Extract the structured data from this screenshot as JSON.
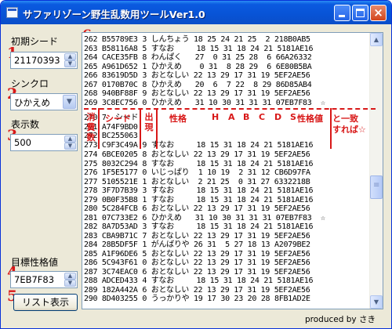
{
  "window": {
    "title": "サファリゾーン野生乱数用ツールVer1.0",
    "controls": {
      "minimize": "_",
      "maximize": "□",
      "close": "×"
    }
  },
  "annotations_numbers": [
    "1",
    "2",
    "3",
    "4",
    "5",
    "6"
  ],
  "left_panel": {
    "initial_seed_label": "初期シード",
    "initial_seed_value": "21170393",
    "synchro_label": "シンクロ",
    "synchro_value": "ひかえめ",
    "display_count_label": "表示数",
    "display_count_value": "500",
    "target_pid_label": "目標性格値",
    "target_pid_value": "7EB7F83",
    "list_button_label": "リスト表示"
  },
  "list_rows_top": [
    "262 B55789E3 3 しんちょう 18 25 24 21 25  2 218B0AB5",
    "263 B58116A8 5 すなお     18 15 31 18 24 21 5181AE16",
    "264 CACE35FB 8 わんぱく   27  0 31 25 28  6 66A26332",
    "265 A961D652 1 ひかえめ    0 31  8 28 29  6 6E80B5BA",
    "266 83619D5D 3 おとなしい 22 13 29 17 31 19 5EF2AE56",
    "267 0170B70C 8 ひかえめ   20  6  7 22  8 29 86D85AB4",
    "268 940BF88F 9 おとなしい 22 13 29 17 31 19 5EF2AE56",
    "269 3C8EC756 0 ひかえめ   31 10 30 31 31 31 07EB7F83  ☆"
  ],
  "list_rows_mid_stubs": [
    "270 7  シード",
    "271 A74F9BD0",
    "272 BC255063",
    "273 C9F3C49A 9 すなお     18 15 31 18 24 21 5181AE16"
  ],
  "list_rows_bottom": [
    "274 6BCE0205 8 おとなしい 22 13 29 17 31 19 5EF2AE56",
    "275 8032C294 8 すなお     18 15 31 18 24 21 5181AE16",
    "276 1F5E5177 0 いじっぱり  1 10 19  2 31 12 CB6D97FA",
    "277 5105521E 1 おとなしい  2 21 25  0 31 27 6332218B",
    "278 3F7D7B39 3 すなお     18 15 31 18 24 21 5181AE16",
    "279 0B0F35B8 1 すなお     18 15 31 18 24 21 5181AE16",
    "280 5C284FCB 6 おとなしい 22 13 29 17 31 19 5EF2AE56",
    "281 07C733E2 6 ひかえめ   31 10 30 31 31 31 07EB7F83  ☆",
    "282 8A7D53AD 3 すなお     18 15 31 18 24 21 5181AE16",
    "283 CBA9B71C 7 おとなしい 22 13 29 17 31 19 5EF2AE56",
    "284 28B5DF5F 1 がんばりや 26 31  5 27 18 13 A2079BE2",
    "285 A1F96DE6 5 おとなしい 22 13 29 17 31 19 5EF2AE56",
    "286 5C943F61 0 おとなしい 22 13 29 17 31 19 5EF2AE56",
    "287 3C74EAC0 6 おとなしい 22 13 29 17 31 19 5EF2AE56",
    "288 ADCED433 4 すなお     18 15 31 18 24 21 5181AE16",
    "289 182A442A 6 おとなしい 22 13 29 17 31 19 5EF2AE56",
    "290 8D403255 0 うっかりや 19 17 30 23 20 28 8FB1AD2E"
  ],
  "overlay_labels": {
    "seed_col": "シード",
    "nature_col": "性格",
    "h": "H",
    "a": "A",
    "b": "B",
    "c": "C",
    "d": "D",
    "s": "S",
    "pid_col": "性格値",
    "match_note_1": "と一致",
    "match_note_2": "すれば☆",
    "consume_vertical": [
      "消",
      "費",
      "数"
    ],
    "appear_vertical": [
      "出",
      "現"
    ]
  },
  "footer_text": "produced by さき",
  "colors": {
    "annotation_red": "#d81818",
    "titlebar_blue": "#0853d6",
    "window_bg": "#ece9d8"
  },
  "icons": [
    "app-icon",
    "minimize-icon",
    "maximize-icon",
    "close-icon",
    "spin-up-icon",
    "spin-down-icon",
    "dropdown-arrow-icon",
    "scroll-up-icon",
    "scroll-down-icon",
    "star-icon"
  ]
}
